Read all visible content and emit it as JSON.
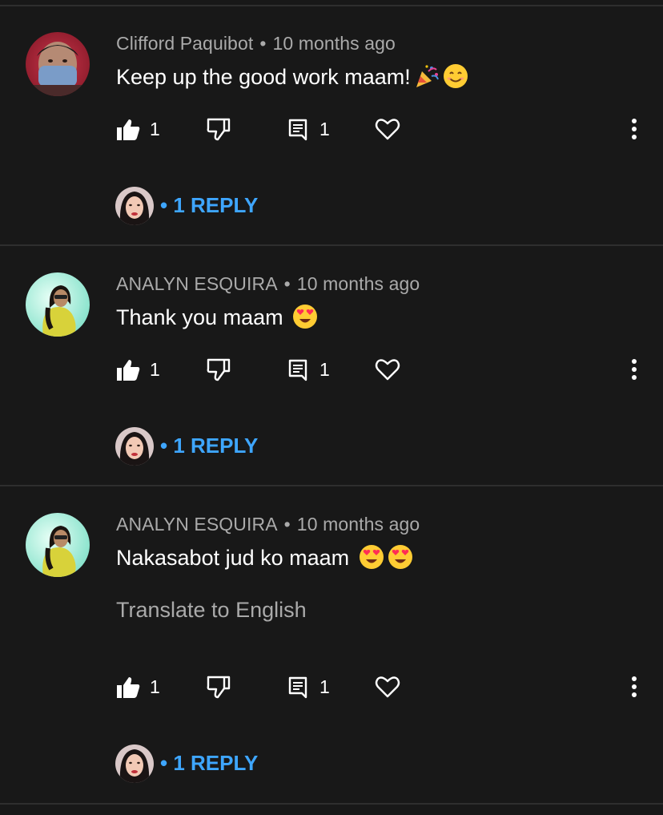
{
  "colors": {
    "background": "#181818",
    "divider": "#2e2e2e",
    "meta_text": "#aaaaaa",
    "body_text": "#ffffff",
    "reply_link": "#3ea6ff"
  },
  "comments": [
    {
      "author": "Clifford Paquibot",
      "separator": "•",
      "time": "10 months ago",
      "text": "Keep up the good work maam!",
      "emojis": [
        "party-popper",
        "smiling-face"
      ],
      "translate_label": null,
      "likes": "1",
      "replies_count": "1",
      "reply_separator": "•",
      "reply_label": "1 REPLY"
    },
    {
      "author": "ANALYN ESQUIRA",
      "separator": "•",
      "time": "10 months ago",
      "text": "Thank you maam",
      "emojis": [
        "heart-eyes"
      ],
      "translate_label": null,
      "likes": "1",
      "replies_count": "1",
      "reply_separator": "•",
      "reply_label": "1 REPLY"
    },
    {
      "author": "ANALYN ESQUIRA",
      "separator": "•",
      "time": "10 months ago",
      "text": "Nakasabot jud ko maam",
      "emojis": [
        "heart-eyes",
        "heart-eyes"
      ],
      "translate_label": "Translate to English",
      "likes": "1",
      "replies_count": "1",
      "reply_separator": "•",
      "reply_label": "1 REPLY"
    }
  ],
  "icons": {
    "like": "thumbs-up-icon",
    "dislike": "thumbs-down-icon",
    "reply": "comment-icon",
    "heart": "heart-icon",
    "more": "more-vert-icon"
  }
}
